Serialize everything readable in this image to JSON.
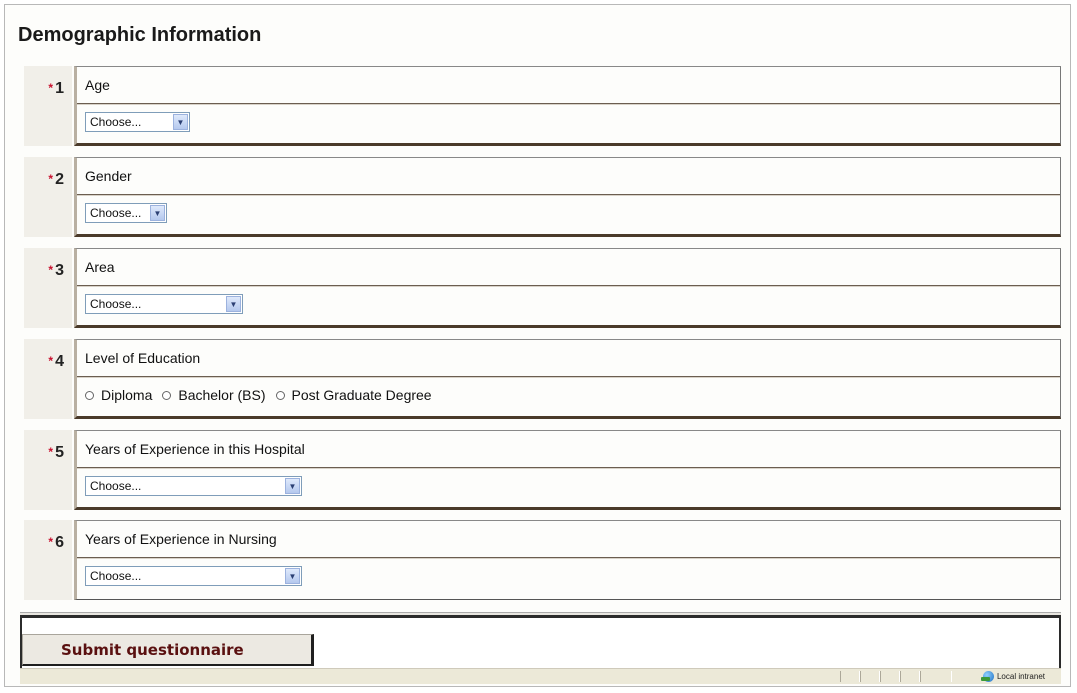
{
  "form": {
    "title": "Demographic Information",
    "required_marker": "*",
    "questions": [
      {
        "number": "1",
        "label": "Age",
        "type": "select",
        "value": "Choose..."
      },
      {
        "number": "2",
        "label": "Gender",
        "type": "select",
        "value": "Choose..."
      },
      {
        "number": "3",
        "label": "Area",
        "type": "select",
        "value": "Choose..."
      },
      {
        "number": "4",
        "label": "Level of Education",
        "type": "radio",
        "options": [
          "Diploma",
          "Bachelor (BS)",
          "Post Graduate Degree"
        ],
        "selected": null
      },
      {
        "number": "5",
        "label": "Years of Experience in this Hospital",
        "type": "select",
        "value": "Choose..."
      },
      {
        "number": "6",
        "label": "Years of Experience in Nursing",
        "type": "select",
        "value": "Choose..."
      }
    ],
    "submit_label": "Submit questionnaire"
  },
  "statusbar": {
    "zone_label": "Local intranet",
    "zone_icon": "globe-icon"
  },
  "colors": {
    "required": "#c8102e",
    "submit_text": "#5a1010",
    "select_border": "#7f9db9"
  }
}
